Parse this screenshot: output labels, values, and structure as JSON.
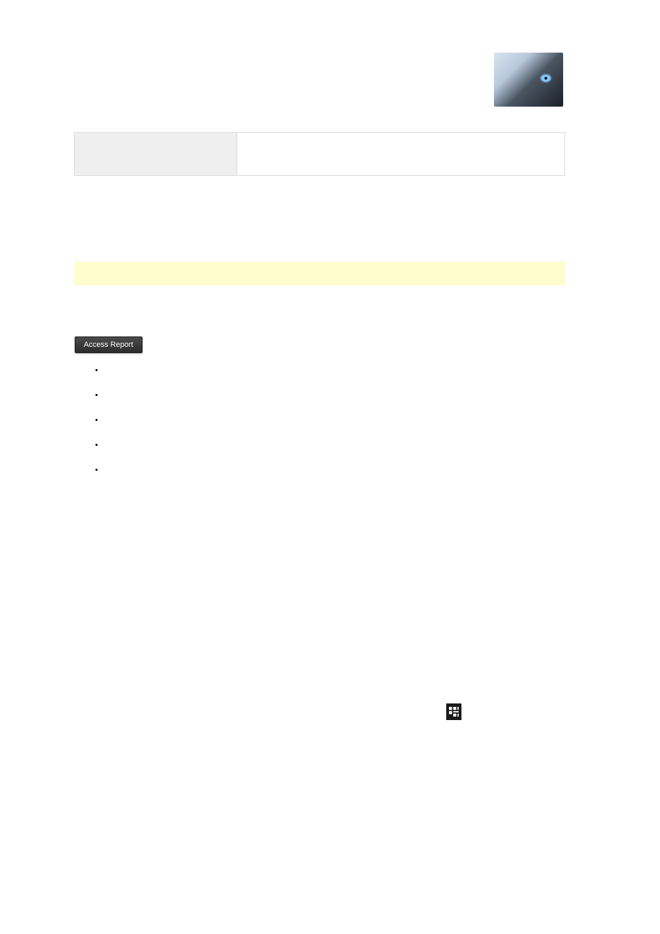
{
  "header_image": {
    "semantic": "wolf-eye-image",
    "accent_eye_color": "#7fc8ff"
  },
  "definition_row": {
    "label": "",
    "value": ""
  },
  "highlight_bar": {
    "text": "",
    "background": "#fffdcd"
  },
  "actions": {
    "access_report_label": "Access Report"
  },
  "bullets": [
    "",
    "",
    "",
    "",
    ""
  ],
  "footer_icon": {
    "semantic": "qr-like-icon"
  }
}
